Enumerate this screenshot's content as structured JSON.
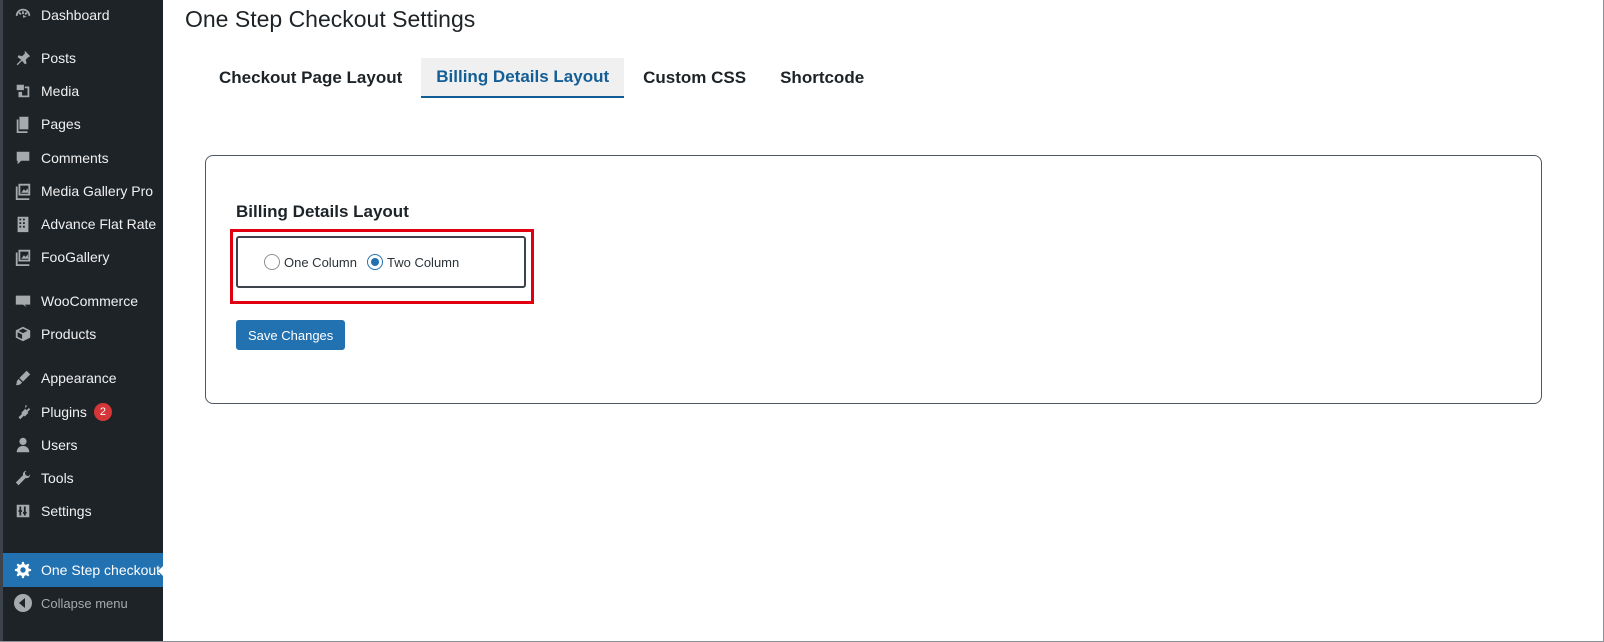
{
  "sidebar": {
    "items": [
      {
        "label": "Dashboard",
        "icon": "dashboard-icon"
      },
      {
        "label": "Posts",
        "icon": "pin-icon"
      },
      {
        "label": "Media",
        "icon": "media-icon"
      },
      {
        "label": "Pages",
        "icon": "pages-icon"
      },
      {
        "label": "Comments",
        "icon": "comment-icon"
      },
      {
        "label": "Media Gallery Pro",
        "icon": "gallery-icon"
      },
      {
        "label": "Advance Flat Rate",
        "icon": "building-icon"
      },
      {
        "label": "FooGallery",
        "icon": "gallery-icon"
      },
      {
        "label": "WooCommerce",
        "icon": "woo-icon"
      },
      {
        "label": "Products",
        "icon": "box-icon"
      },
      {
        "label": "Appearance",
        "icon": "brush-icon"
      },
      {
        "label": "Plugins",
        "icon": "plug-icon",
        "badge": "2"
      },
      {
        "label": "Users",
        "icon": "user-icon"
      },
      {
        "label": "Tools",
        "icon": "wrench-icon"
      },
      {
        "label": "Settings",
        "icon": "sliders-icon"
      },
      {
        "label": "One Step checkout",
        "icon": "gear-icon",
        "current": true
      }
    ],
    "collapse_label": "Collapse menu"
  },
  "main": {
    "title": "One Step Checkout Settings",
    "tabs": [
      {
        "label": "Checkout Page Layout"
      },
      {
        "label": "Billing Details Layout",
        "active": true
      },
      {
        "label": "Custom CSS"
      },
      {
        "label": "Shortcode"
      }
    ],
    "section_title": "Billing Details Layout",
    "options": [
      {
        "label": "One Column",
        "checked": false
      },
      {
        "label": "Two Column",
        "checked": true
      }
    ],
    "save_label": "Save Changes"
  },
  "colors": {
    "sidebar_bg": "#1d2327",
    "accent": "#2271b1",
    "highlight": "#e0000f",
    "badge": "#d63638"
  }
}
